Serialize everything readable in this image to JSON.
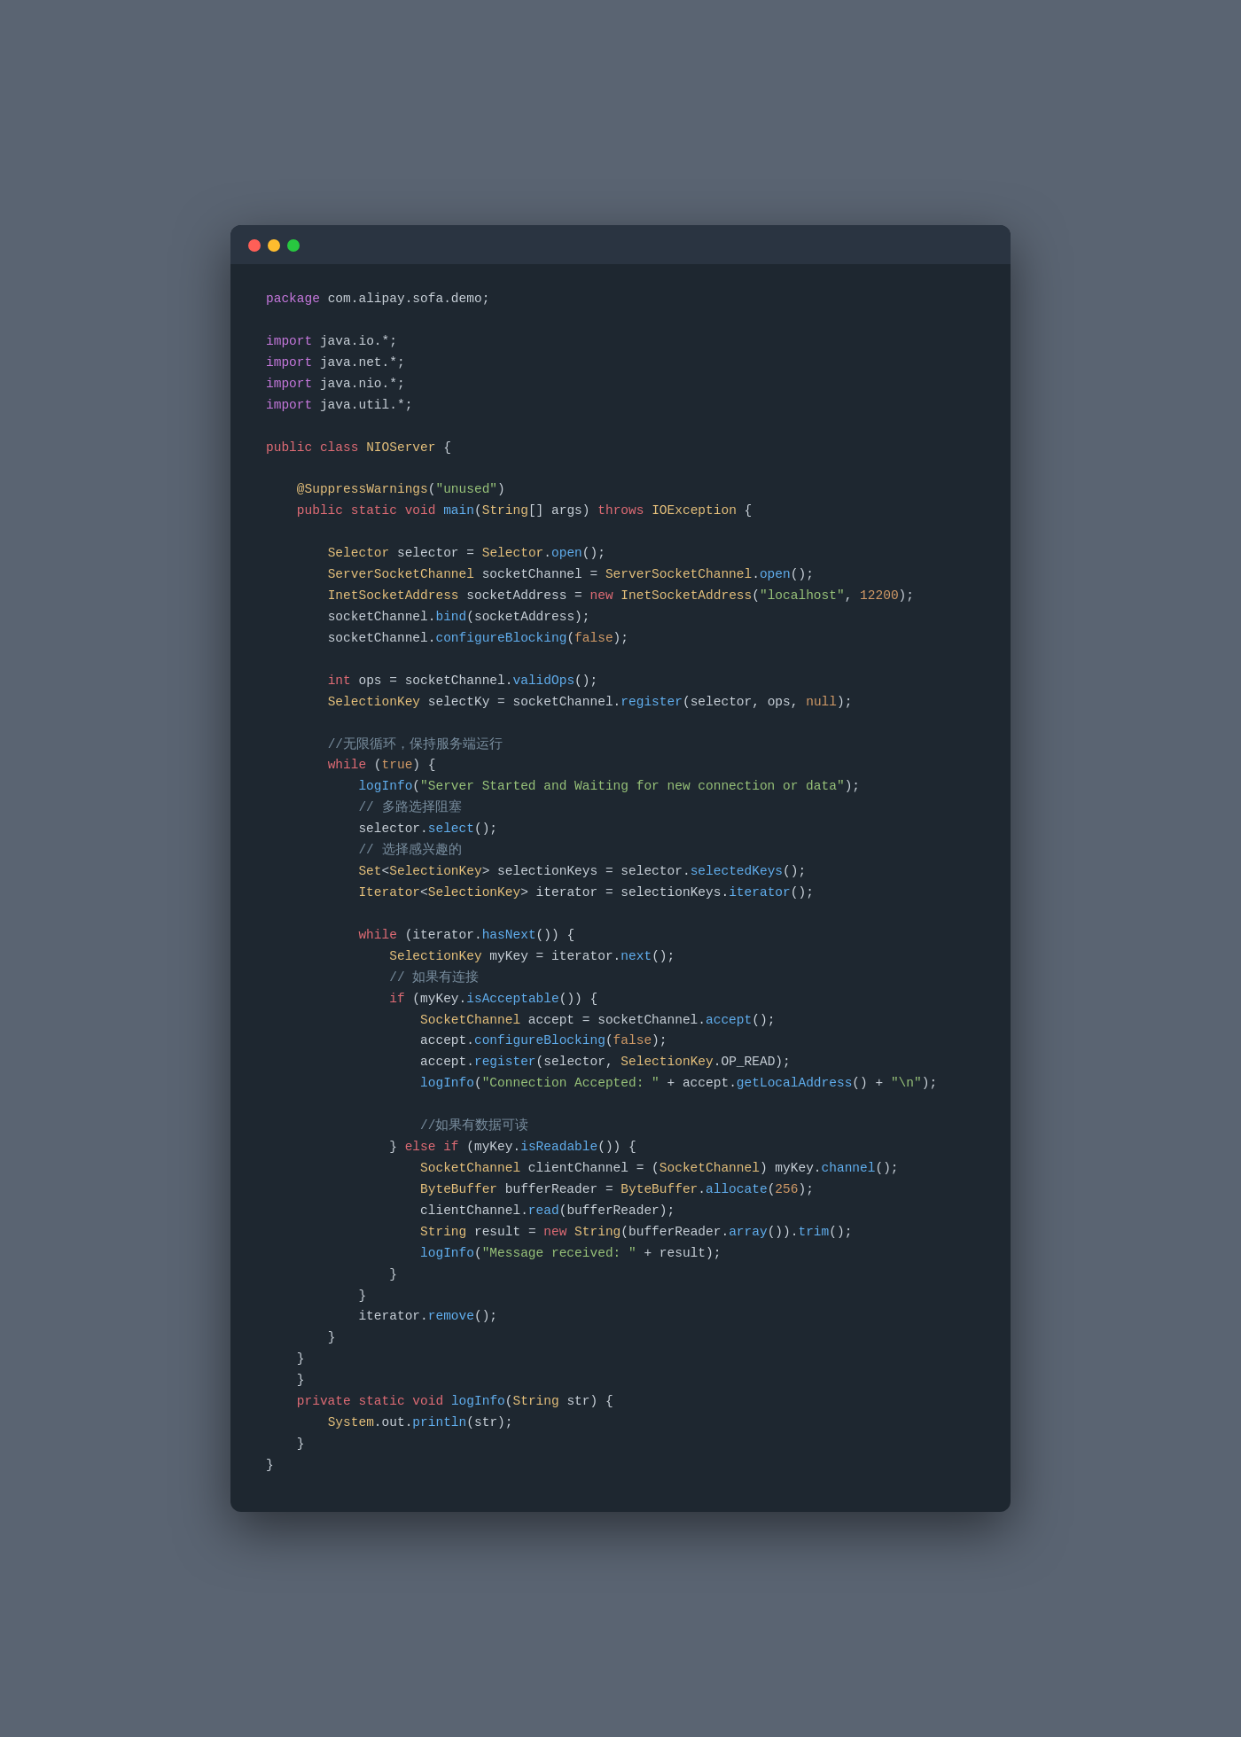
{
  "window": {
    "dots": [
      "red",
      "yellow",
      "green"
    ]
  },
  "code": {
    "lines": [
      "package com.alipay.sofa.demo;",
      "",
      "import java.io.*;",
      "import java.net.*;",
      "import java.nio.*;",
      "import java.util.*;",
      "",
      "public class NIOServer {",
      "",
      "    @SuppressWarnings(\"unused\")",
      "    public static void main(String[] args) throws IOException {",
      "",
      "        Selector selector = Selector.open();",
      "        ServerSocketChannel socketChannel = ServerSocketChannel.open();",
      "        InetSocketAddress socketAddress = new InetSocketAddress(\"localhost\", 12200);",
      "        socketChannel.bind(socketAddress);",
      "        socketChannel.configureBlocking(false);",
      "",
      "        int ops = socketChannel.validOps();",
      "        SelectionKey selectKy = socketChannel.register(selector, ops, null);",
      "",
      "        //无限循环，保持服务端运行",
      "        while (true) {",
      "            logInfo(\"Server Started and Waiting for new connection or data\");",
      "            // 多路选择阻塞",
      "            selector.select();",
      "            // 选择感兴趣的",
      "            Set<SelectionKey> selectionKeys = selector.selectedKeys();",
      "            Iterator<SelectionKey> iterator = selectionKeys.iterator();",
      "",
      "            while (iterator.hasNext()) {",
      "                SelectionKey myKey = iterator.next();",
      "                // 如果有连接",
      "                if (myKey.isAcceptable()) {",
      "                    SocketChannel accept = socketChannel.accept();",
      "                    accept.configureBlocking(false);",
      "                    accept.register(selector, SelectionKey.OP_READ);",
      "                    logInfo(\"Connection Accepted: \" + accept.getLocalAddress() + \"\\n\");",
      "",
      "                    //如果有数据可读",
      "                } else if (myKey.isReadable()) {",
      "                    SocketChannel clientChannel = (SocketChannel) myKey.channel();",
      "                    ByteBuffer bufferReader = ByteBuffer.allocate(256);",
      "                    clientChannel.read(bufferReader);",
      "                    String result = new String(bufferReader.array()).trim();",
      "                    logInfo(\"Message received: \" + result);",
      "                }",
      "            }",
      "            iterator.remove();",
      "        }",
      "    }",
      "    }",
      "    private static void logInfo(String str) {",
      "        System.out.println(str);",
      "    }",
      "}"
    ]
  }
}
